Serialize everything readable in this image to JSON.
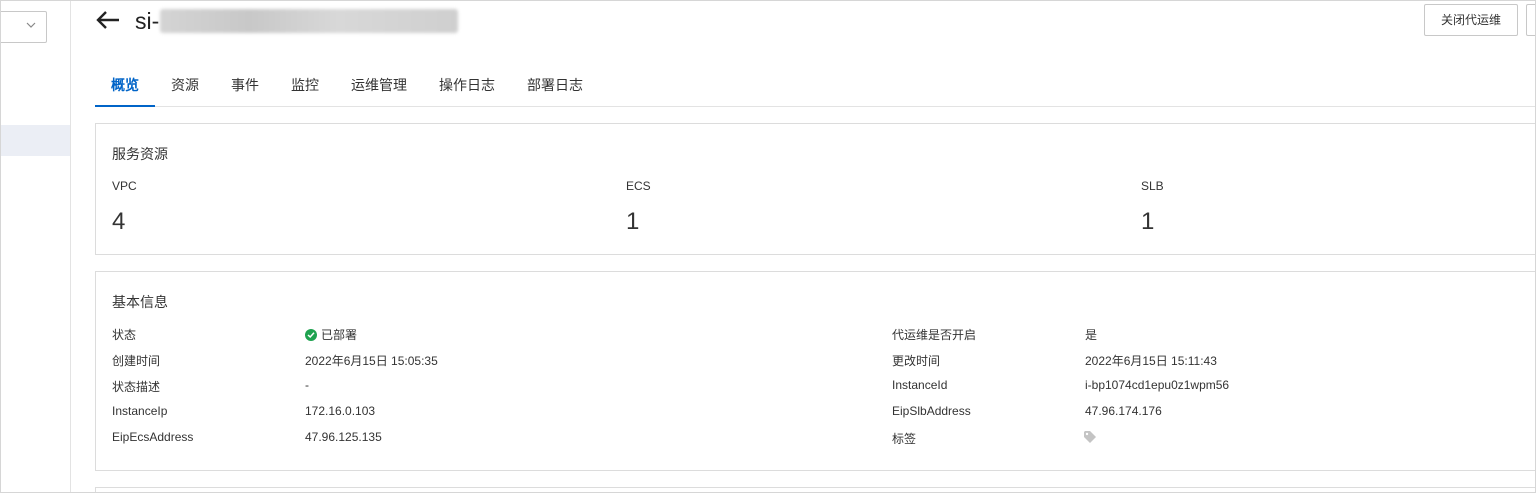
{
  "header": {
    "title_prefix": "si-",
    "close_ops_label": "关闭代运维"
  },
  "tabs": [
    {
      "label": "概览",
      "active": true
    },
    {
      "label": "资源",
      "active": false
    },
    {
      "label": "事件",
      "active": false
    },
    {
      "label": "监控",
      "active": false
    },
    {
      "label": "运维管理",
      "active": false
    },
    {
      "label": "操作日志",
      "active": false
    },
    {
      "label": "部署日志",
      "active": false
    }
  ],
  "service_resources": {
    "title": "服务资源",
    "metrics": [
      {
        "label": "VPC",
        "value": "4"
      },
      {
        "label": "ECS",
        "value": "1"
      },
      {
        "label": "SLB",
        "value": "1"
      }
    ]
  },
  "basic_info": {
    "title": "基本信息",
    "left": [
      {
        "label": "状态",
        "value": "已部署"
      },
      {
        "label": "创建时间",
        "value": "2022年6月15日 15:05:35"
      },
      {
        "label": "状态描述",
        "value": "-"
      },
      {
        "label": "InstanceIp",
        "value": "172.16.0.103"
      },
      {
        "label": "EipEcsAddress",
        "value": "47.96.125.135"
      }
    ],
    "right": [
      {
        "label": "代运维是否开启",
        "value": "是"
      },
      {
        "label": "更改时间",
        "value": "2022年6月15日 15:11:43"
      },
      {
        "label": "InstanceId",
        "value": "i-bp1074cd1epu0z1wpm56"
      },
      {
        "label": "EipSlbAddress",
        "value": "47.96.174.176"
      },
      {
        "label": "标签",
        "value": ""
      }
    ]
  },
  "colors": {
    "accent": "#0064c8",
    "status_success": "#1ea24f"
  },
  "icons": {
    "back": "arrow-left-icon",
    "status": "check-circle-icon",
    "tag": "tag-icon",
    "select": "chevron-down-icon"
  }
}
